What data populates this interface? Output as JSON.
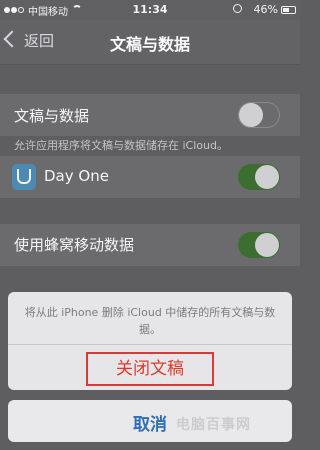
{
  "status_bar": {
    "carrier": "中国移动",
    "time": "11:34",
    "battery": "46%"
  },
  "nav": {
    "back_label": "返回",
    "title": "文稿与数据"
  },
  "settings": {
    "docs_data": {
      "label": "文稿与数据",
      "on": false,
      "footnote": "允许应用程序将文稿与数据储存在 iCloud。"
    },
    "day_one": {
      "label": "Day One",
      "on": true
    },
    "cellular": {
      "label": "使用蜂窝移动数据",
      "on": true
    }
  },
  "action_sheet": {
    "message": "将从此 iPhone 删除 iCloud 中储存的所有文稿与数据。",
    "destructive_label": "关闭文稿",
    "cancel_label": "取消"
  },
  "watermark": "电脑百事网",
  "colors": {
    "destructive": "#e0392b",
    "toggle_on": "#3c6e32",
    "cancel": "#2f6fb5",
    "highlight_box": "#d93a3a"
  }
}
